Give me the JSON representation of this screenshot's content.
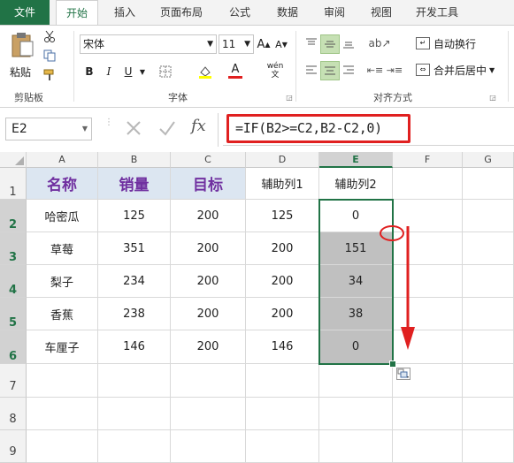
{
  "ribbon_tabs": [
    "文件",
    "开始",
    "插入",
    "页面布局",
    "公式",
    "数据",
    "审阅",
    "视图",
    "开发工具"
  ],
  "clipboard": {
    "paste_label": "粘贴",
    "group_label": "剪贴板"
  },
  "font": {
    "name": "宋体",
    "size": "11",
    "group_label": "字体",
    "bold": "B",
    "italic": "I",
    "underline": "U",
    "font_color_letter": "A",
    "phonetic": "wén"
  },
  "alignment": {
    "wrap_text": "自动换行",
    "merge_center": "合并后居中",
    "group_label": "对齐方式"
  },
  "formula_bar": {
    "name_box": "E2",
    "fx": "fx",
    "formula": "=IF(B2>=C2,B2-C2,0)"
  },
  "columns": [
    "A",
    "B",
    "C",
    "D",
    "E",
    "F",
    "G"
  ],
  "rows": [
    "1",
    "2",
    "3",
    "4",
    "5",
    "6",
    "7",
    "8",
    "9"
  ],
  "header_row": [
    "名称",
    "销量",
    "目标",
    "辅助列1",
    "辅助列2"
  ],
  "data_rows": [
    [
      "哈密瓜",
      "125",
      "200",
      "125",
      "0"
    ],
    [
      "草莓",
      "351",
      "200",
      "200",
      "151"
    ],
    [
      "梨子",
      "234",
      "200",
      "200",
      "34"
    ],
    [
      "香蕉",
      "238",
      "200",
      "200",
      "38"
    ],
    [
      "车厘子",
      "146",
      "200",
      "146",
      "0"
    ]
  ],
  "colors": {
    "accent": "#217346",
    "header_fill": "#dce6f1",
    "header_text": "#7030a0",
    "selection_fill": "#c0c0c0",
    "annotation": "#e02020"
  },
  "icons": [
    "scissors-icon",
    "copy-icon",
    "format-painter-icon",
    "fill-color-icon",
    "font-color-icon",
    "cancel-icon",
    "check-icon",
    "fx-icon",
    "autofill-options-icon"
  ]
}
